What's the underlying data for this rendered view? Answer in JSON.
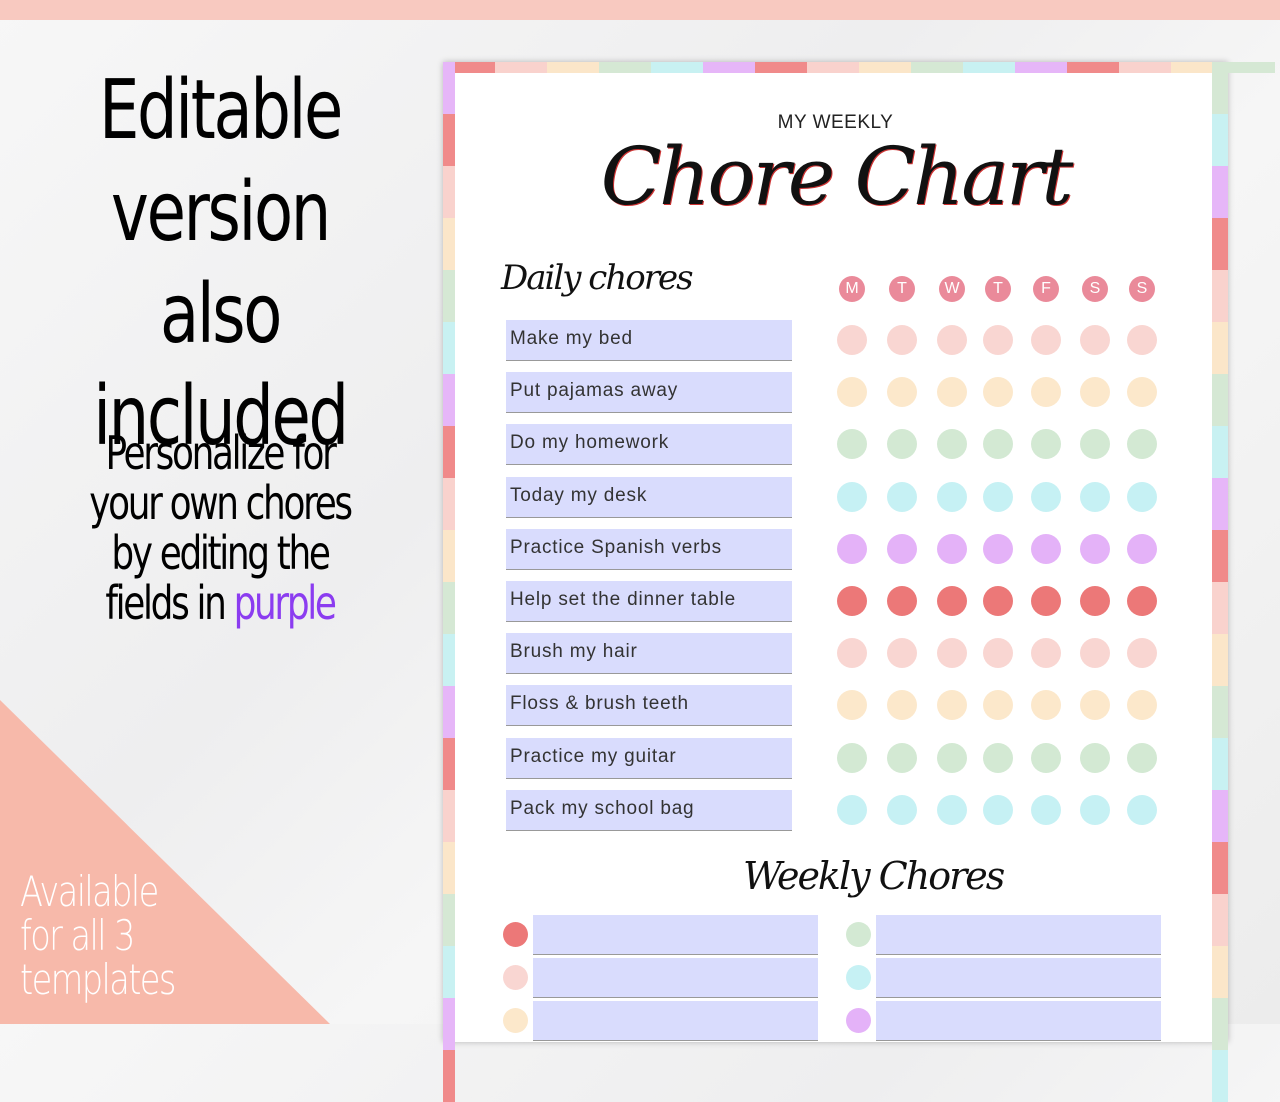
{
  "promo": {
    "line1": "Editable",
    "line2": "version also",
    "line3": "included",
    "personalize1": "Personalize for",
    "personalize2": "your own chores",
    "personalize3": "by editing the",
    "personalize4": "fields in",
    "personalize_word": "purple",
    "available1": "Available",
    "available2": "for all 3",
    "available3": "templates"
  },
  "chart": {
    "subtitle": "MY WEEKLY",
    "title": "Chore Chart",
    "daily_heading": "Daily chores",
    "weekly_heading": "Weekly Chores",
    "days": [
      "M",
      "T",
      "W",
      "T",
      "F",
      "S",
      "S"
    ],
    "chores": [
      "Make my bed",
      "Put pajamas away",
      "Do my homework",
      "Today my desk",
      "Practice Spanish verbs",
      "Help set the dinner table",
      "Brush my hair",
      "Floss & brush teeth",
      "Practice my guitar",
      "Pack my school bag"
    ]
  },
  "colors": {
    "day_badge": "#ea8a9a",
    "field": "#d9dcfd",
    "accent_purple": "#8b3cf0",
    "rows": [
      "#f9d6d2",
      "#fce8cb",
      "#d3e9d3",
      "#c6f1f4",
      "#e4b2f8",
      "#ec7878"
    ]
  }
}
